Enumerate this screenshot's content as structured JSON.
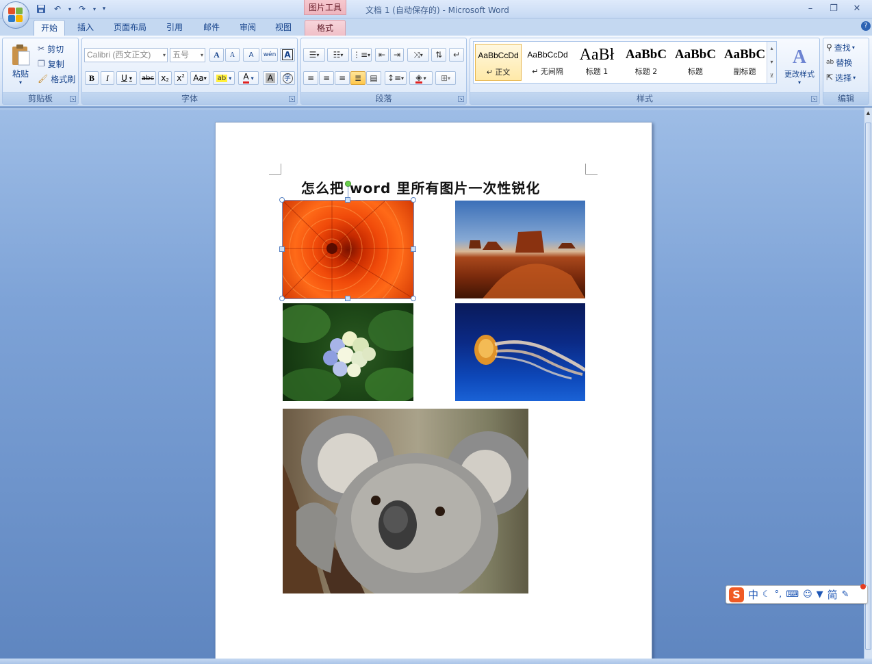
{
  "window": {
    "title": "文档 1 (自动保存的) - Microsoft Word",
    "contextual_tab_group": "图片工具",
    "controls": {
      "minimize": "–",
      "restore": "❐",
      "close": "✕"
    }
  },
  "tabs": [
    "开始",
    "插入",
    "页面布局",
    "引用",
    "邮件",
    "审阅",
    "视图",
    "格式"
  ],
  "help": "?",
  "clipboard": {
    "paste": "粘贴",
    "cut": "剪切",
    "copy": "复制",
    "format_painter": "格式刷",
    "label": "剪贴板"
  },
  "font": {
    "name_value": "Calibri (西文正文)",
    "size_value": "五号",
    "grow": "A",
    "shrink": "A",
    "clear_format": "A",
    "phonetic": "wén",
    "border_char": "A",
    "bold": "B",
    "italic": "I",
    "underline": "U",
    "strikethrough": "abc",
    "subscript": "x",
    "superscript": "x",
    "change_case": "Aa",
    "highlight": "ab",
    "font_color": "A",
    "shading": "A",
    "enclose": "字",
    "label": "字体"
  },
  "paragraph": {
    "label": "段落"
  },
  "styles": {
    "items": [
      {
        "sample": "AaBbCcDd",
        "name": "↵ 正文"
      },
      {
        "sample": "AaBbCcDd",
        "name": "↵ 无间隔"
      },
      {
        "sample": "AaBł",
        "name": "标题 1"
      },
      {
        "sample": "AaBbC",
        "name": "标题 2"
      },
      {
        "sample": "AaBbC",
        "name": "标题"
      },
      {
        "sample": "AaBbC",
        "name": "副标题"
      }
    ],
    "change_styles": "更改样式",
    "label": "样式"
  },
  "editing": {
    "find": "查找",
    "replace": "替换",
    "select": "选择",
    "label": "编辑"
  },
  "document": {
    "title_text": "怎么把 word 里所有图片一次性锐化"
  },
  "ime": {
    "logo": "S",
    "lang": "中",
    "mode": "简"
  }
}
